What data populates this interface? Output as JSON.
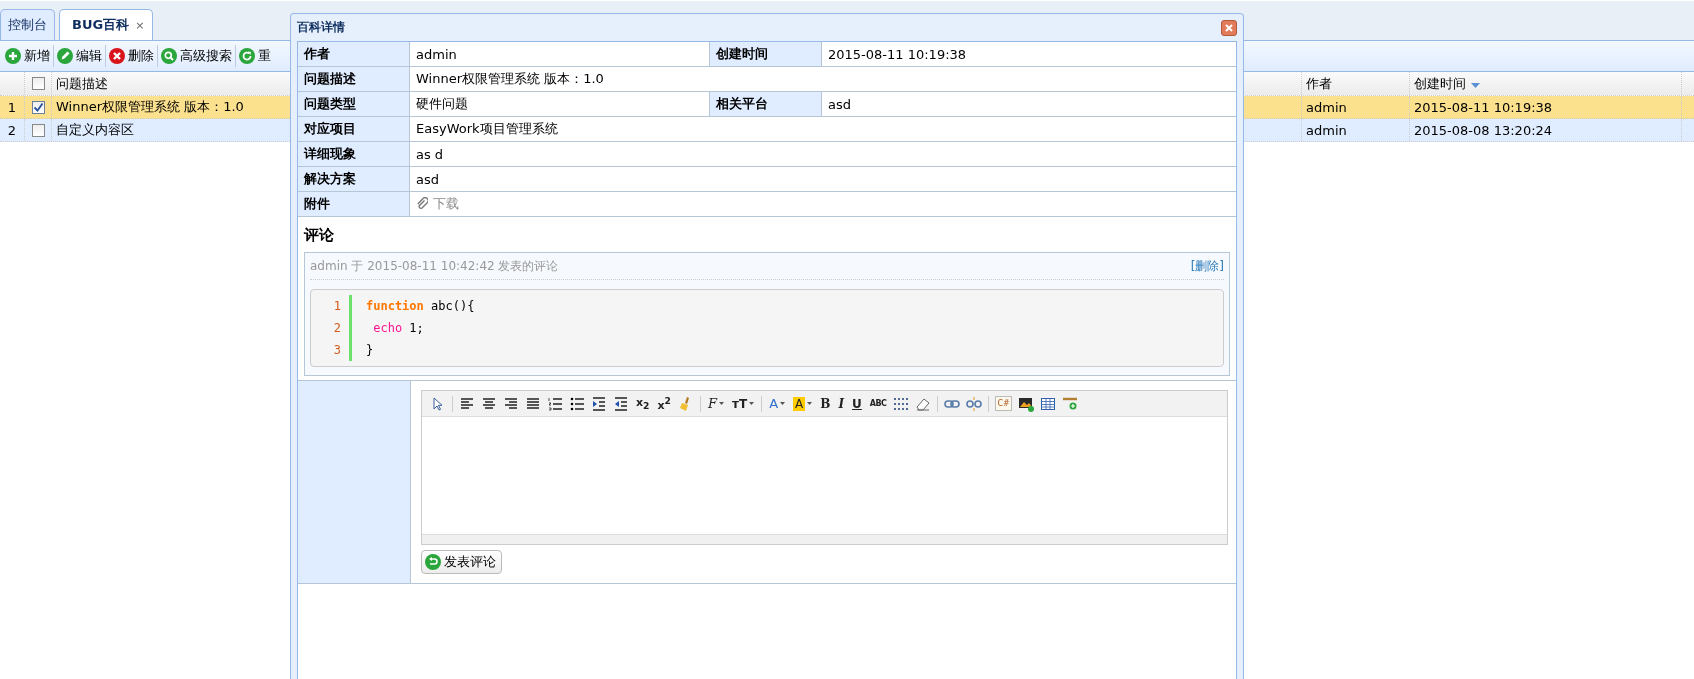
{
  "tabs": [
    {
      "label": "控制台",
      "selected": false
    },
    {
      "label": "BUG百科",
      "selected": true,
      "close": "×"
    }
  ],
  "toolbar": [
    {
      "label": "新增",
      "kind": "add"
    },
    {
      "label": "编辑",
      "kind": "edit"
    },
    {
      "label": "删除",
      "kind": "delete"
    },
    {
      "label": "高级搜索",
      "kind": "search"
    },
    {
      "label": "重",
      "kind": "reload"
    }
  ],
  "grid": {
    "columns": [
      {
        "label": "问题描述",
        "sorted": false
      },
      {
        "label": "作者",
        "sorted": false
      },
      {
        "label": "创建时间",
        "sorted": true
      }
    ],
    "header_checked": false,
    "rows": [
      {
        "number": "1",
        "checked": true,
        "selected": true,
        "description": "Winner权限管理系统 版本：1.0",
        "author": "admin",
        "created": "2015-08-11 10:19:38"
      },
      {
        "number": "2",
        "checked": false,
        "selected": false,
        "description": "自定义内容区",
        "author": "admin",
        "created": "2015-08-08 13:20:24"
      }
    ]
  },
  "dialog": {
    "title": "百科详情",
    "details": [
      [
        {
          "label": "作者",
          "value": "admin"
        },
        {
          "label": "创建时间",
          "value": "2015-08-11 10:19:38"
        }
      ],
      [
        {
          "label": "问题描述",
          "value": "Winner权限管理系统 版本：1.0"
        }
      ],
      [
        {
          "label": "问题类型",
          "value": "硬件问题"
        },
        {
          "label": "相关平台",
          "value": "asd"
        }
      ],
      [
        {
          "label": "对应项目",
          "value": "EasyWork项目管理系统"
        }
      ],
      [
        {
          "label": "详细现象",
          "value": "as d"
        }
      ],
      [
        {
          "label": "解决方案",
          "value": "asd"
        }
      ],
      [
        {
          "label": "附件",
          "value": "下载",
          "kind": "attachment"
        }
      ]
    ],
    "comments_title": "评论",
    "comments": [
      {
        "meta": "admin 于 2015-08-11 10:42:42 发表的评论",
        "delete": "[删除]",
        "code": [
          {
            "number": "1",
            "tokens": [
              {
                "kind": "keyword",
                "text": "function"
              },
              {
                "kind": "plain",
                "text": " abc(){"
              }
            ]
          },
          {
            "number": "2",
            "tokens": [
              {
                "kind": "func",
                "text": " echo"
              },
              {
                "kind": "plain",
                "text": " 1;"
              }
            ]
          },
          {
            "number": "3",
            "tokens": [
              {
                "kind": "plain",
                "text": "}"
              }
            ]
          }
        ]
      }
    ],
    "editor_tools": [
      {
        "kind": "select"
      },
      {
        "kind": "sep"
      },
      {
        "kind": "align-left"
      },
      {
        "kind": "align-center"
      },
      {
        "kind": "align-right"
      },
      {
        "kind": "justify"
      },
      {
        "kind": "ordered-list"
      },
      {
        "kind": "bullet-list"
      },
      {
        "kind": "indent"
      },
      {
        "kind": "outdent"
      },
      {
        "kind": "subscript",
        "text": "x$_{2}$"
      },
      {
        "kind": "superscript",
        "text": "x$^{2}$"
      },
      {
        "kind": "brush"
      },
      {
        "kind": "sep"
      },
      {
        "kind": "font-family",
        "text": "F"
      },
      {
        "kind": "font-size",
        "text": "тT"
      },
      {
        "kind": "sep"
      },
      {
        "kind": "font-color",
        "text": "A"
      },
      {
        "kind": "back-color",
        "text": "A"
      },
      {
        "kind": "bold",
        "text": "B"
      },
      {
        "kind": "italic",
        "text": "I"
      },
      {
        "kind": "underline",
        "text": "U"
      },
      {
        "kind": "strike",
        "text": "ABC"
      },
      {
        "kind": "dots"
      },
      {
        "kind": "eraser"
      },
      {
        "kind": "sep"
      },
      {
        "kind": "link"
      },
      {
        "kind": "unlink"
      },
      {
        "kind": "sep"
      },
      {
        "kind": "code",
        "text": "C#"
      },
      {
        "kind": "image"
      },
      {
        "kind": "table"
      },
      {
        "kind": "rule"
      }
    ],
    "submit": "发表评论"
  }
}
